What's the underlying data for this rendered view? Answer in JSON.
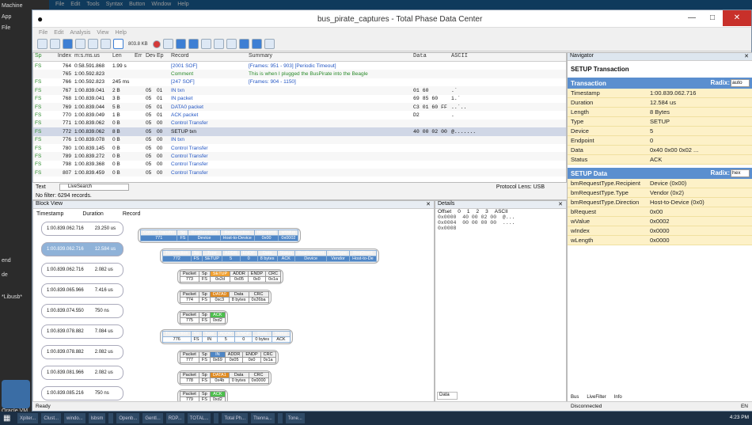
{
  "window": {
    "title": "bus_pirate_captures - Total Phase Data Center"
  },
  "bg_left": {
    "labels": [
      "Machine",
      "App",
      "File"
    ],
    "side_text": [
      "end",
      "de",
      "*Libusb*"
    ],
    "oracle": "Oracle VM VirtualBox"
  },
  "menu_ghost": [
    "File",
    "Edit",
    "Tools",
    "Syntax",
    "Button",
    "Window",
    "Help"
  ],
  "menu": [
    "File",
    "Edit",
    "Analysis",
    "View",
    "Help"
  ],
  "toolbar": {
    "size_label": "803.8 KB"
  },
  "grid": {
    "headers": [
      "Sp",
      "Index",
      "m:s.ms.us",
      "Len",
      "Err",
      "Dev",
      "Ep",
      "Record",
      "Summary",
      "Data",
      "ASCII"
    ],
    "rows": [
      {
        "sp": "FS",
        "idx": "764",
        "time": "0:58.591.868",
        "len": "1.99 s",
        "err": "",
        "dev": "",
        "ep": "",
        "rec": "[2001 SOF]",
        "sum": "[Frames: 951 - 903] [Periodic Timeout]",
        "data": "",
        "ascii": "",
        "cls": "blue"
      },
      {
        "sp": "",
        "idx": "765",
        "time": "1:00.592.823",
        "len": "",
        "err": "",
        "dev": "",
        "ep": "",
        "rec": "Comment",
        "sum": "This is when I plugged the BusPirate into the Beagle",
        "data": "",
        "ascii": "",
        "cls": "green"
      },
      {
        "sp": "FS",
        "idx": "766",
        "time": "1:00.592.823",
        "len": "245 ms",
        "err": "",
        "dev": "",
        "ep": "",
        "rec": "[247 SOF]",
        "sum": "[Frames: 904 - 1150]",
        "data": "",
        "ascii": "",
        "cls": "blue"
      },
      {
        "sp": "FS",
        "idx": "767",
        "time": "1:00.839.041",
        "len": "2 B",
        "err": "",
        "dev": "05",
        "ep": "01",
        "rec": "IN txn",
        "sum": "",
        "data": "01 60",
        "ascii": ".`",
        "cls": ""
      },
      {
        "sp": "FS",
        "idx": "768",
        "time": "1:00.839.041",
        "len": "3 B",
        "err": "",
        "dev": "05",
        "ep": "01",
        "rec": "IN packet",
        "sum": "",
        "data": "69 85 60",
        "ascii": "i.`",
        "cls": ""
      },
      {
        "sp": "FS",
        "idx": "769",
        "time": "1:00.839.044",
        "len": "5 B",
        "err": "",
        "dev": "05",
        "ep": "01",
        "rec": "DATA0 packet",
        "sum": "",
        "data": "C3 01 60 FF F7",
        "ascii": "..`..",
        "cls": ""
      },
      {
        "sp": "FS",
        "idx": "770",
        "time": "1:00.839.049",
        "len": "1 B",
        "err": "",
        "dev": "05",
        "ep": "01",
        "rec": "ACK packet",
        "sum": "",
        "data": "D2",
        "ascii": ".",
        "cls": ""
      },
      {
        "sp": "FS",
        "idx": "771",
        "time": "1:00.839.062",
        "len": "0 B",
        "err": "",
        "dev": "05",
        "ep": "00",
        "rec": "Control Transfer",
        "sum": "",
        "data": "",
        "ascii": "",
        "cls": ""
      },
      {
        "sp": "FS",
        "idx": "772",
        "time": "1:00.839.062",
        "len": "8 B",
        "err": "",
        "dev": "05",
        "ep": "00",
        "rec": "SETUP txn",
        "sum": "",
        "data": "40 00 02 00 0..",
        "ascii": "@.......",
        "cls": "sel"
      },
      {
        "sp": "FS",
        "idx": "776",
        "time": "1:00.839.078",
        "len": "0 B",
        "err": "",
        "dev": "05",
        "ep": "00",
        "rec": "IN txn",
        "sum": "",
        "data": "",
        "ascii": "",
        "cls": ""
      },
      {
        "sp": "FS",
        "idx": "780",
        "time": "1:00.839.145",
        "len": "0 B",
        "err": "",
        "dev": "05",
        "ep": "00",
        "rec": "Control Transfer",
        "sum": "",
        "data": "",
        "ascii": "",
        "cls": ""
      },
      {
        "sp": "FS",
        "idx": "789",
        "time": "1:00.839.272",
        "len": "0 B",
        "err": "",
        "dev": "05",
        "ep": "00",
        "rec": "Control Transfer",
        "sum": "",
        "data": "",
        "ascii": "",
        "cls": ""
      },
      {
        "sp": "FS",
        "idx": "798",
        "time": "1:00.839.368",
        "len": "0 B",
        "err": "",
        "dev": "05",
        "ep": "00",
        "rec": "Control Transfer",
        "sum": "",
        "data": "",
        "ascii": "",
        "cls": ""
      },
      {
        "sp": "FS",
        "idx": "807",
        "time": "1:00.839.459",
        "len": "0 B",
        "err": "",
        "dev": "05",
        "ep": "00",
        "rec": "Control Transfer",
        "sum": "",
        "data": "",
        "ascii": "",
        "cls": ""
      }
    ]
  },
  "filter": {
    "type": "Text",
    "search": "LiveSearch",
    "status": "No filter: 6294 records.",
    "protocol": "Protocol Lens: USB"
  },
  "blockview": {
    "title": "Block View",
    "cols": [
      "Timestamp",
      "Duration",
      "Record"
    ],
    "rows": [
      {
        "ts": "1:00.839.062.716",
        "dur": "23.250 us",
        "sel": false
      },
      {
        "ts": "1:00.839.062.716",
        "dur": "12.584 us",
        "sel": true
      },
      {
        "ts": "1:00.839.062.716",
        "dur": "2.082 us",
        "sel": false
      },
      {
        "ts": "1:00.839.065.966",
        "dur": "7.416 us",
        "sel": false
      },
      {
        "ts": "1:00.839.074.550",
        "dur": "750 ns",
        "sel": false
      },
      {
        "ts": "1:00.839.078.882",
        "dur": "7.084 us",
        "sel": false
      },
      {
        "ts": "1:00.839.078.882",
        "dur": "2.082 us",
        "sel": false
      },
      {
        "ts": "1:00.839.081.966",
        "dur": "2.082 us",
        "sel": false
      },
      {
        "ts": "1:00.839.085.216",
        "dur": "750 ns",
        "sel": false
      }
    ]
  },
  "details": {
    "title": "Details",
    "head": [
      "Offset",
      "0",
      "1",
      "2",
      "3",
      "ASCII"
    ],
    "lines": [
      "0x0000  40 00 02 00  @...",
      "0x0004  00 00 00 00  ....",
      "0x0008"
    ],
    "tab": "Data"
  },
  "navigator": {
    "title": "Navigator",
    "heading": "SETUP Transaction",
    "sec1": "Transaction",
    "radix1": "Radix:",
    "radix1v": "auto",
    "fields1": [
      [
        "Timestamp",
        "1:00.839.062.716"
      ],
      [
        "Duration",
        "12.584 us"
      ],
      [
        "Length",
        "8 Bytes"
      ],
      [
        "Type",
        "SETUP"
      ],
      [
        "Device",
        "5"
      ],
      [
        "Endpoint",
        "0"
      ],
      [
        "Data",
        "0x40 0x00 0x02 ..."
      ],
      [
        "Status",
        "ACK"
      ]
    ],
    "sec2": "SETUP Data",
    "radix2": "Radix:",
    "radix2v": "hex",
    "fields2": [
      [
        "bmRequestType.Recipient",
        "Device (0x00)"
      ],
      [
        "bmRequestType.Type",
        "Vendor (0x2)"
      ],
      [
        "bmRequestType.Direction",
        "Host-to-Device (0x0)"
      ],
      [
        "bRequest",
        "0x00"
      ],
      [
        "wValue",
        "0x0002"
      ],
      [
        "wIndex",
        "0x0000"
      ],
      [
        "wLength",
        "0x0000"
      ]
    ],
    "tabs": [
      "Bus",
      "LiveFilter",
      "Info"
    ]
  },
  "status": {
    "left": "Ready",
    "mid": "Disconnected",
    "right": "EN"
  },
  "taskbar": {
    "items": [
      "Xpiter...",
      "Clust...",
      "windo...",
      "lsbsm",
      "",
      "Openb...",
      "Gentl...",
      "RDP...",
      "TOTAL...",
      "",
      "Total Ph...",
      "Ttenna...",
      "",
      "Tone..."
    ],
    "clock": "4:23 PM"
  }
}
